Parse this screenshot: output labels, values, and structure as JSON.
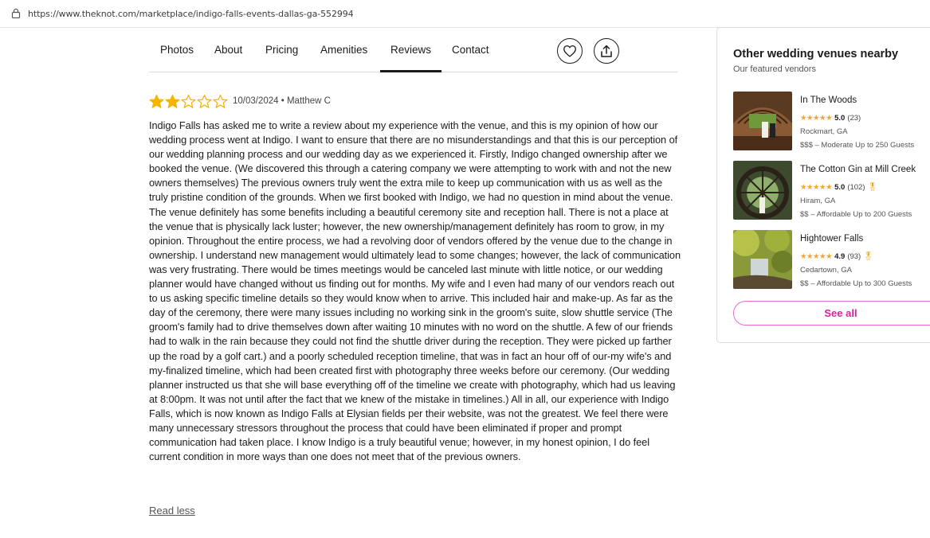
{
  "browser": {
    "url": "https://www.theknot.com/marketplace/indigo-falls-events-dallas-ga-552994"
  },
  "nav": {
    "tabs": [
      {
        "label": "Photos"
      },
      {
        "label": "About"
      },
      {
        "label": "Pricing"
      },
      {
        "label": "Amenities"
      },
      {
        "label": "Reviews",
        "active": true
      },
      {
        "label": "Contact"
      }
    ]
  },
  "review": {
    "rating": 2,
    "max_rating": 5,
    "date": "10/03/2024",
    "author": "Matthew C",
    "meta": "10/03/2024 • Matthew C",
    "text": "Indigo Falls has asked me to write a review about my experience with the venue, and this is my opinion of how our wedding process went at Indigo. I want to ensure that there are no misunderstandings and that this is our perception of our wedding planning process and our wedding day as we experienced it. Firstly, Indigo changed ownership after we booked the venue. (We discovered this through a catering company we were attempting to work with and not the new owners themselves) The previous owners truly went the extra mile to keep up communication with us as well as the truly pristine condition of the grounds. When we first booked with Indigo, we had no question in mind about the venue. The venue definitely has some benefits including a beautiful ceremony site and reception hall. There is not a place at the venue that is physically lack luster; however, the new ownership/management definitely has room to grow, in my opinion. Throughout the entire process, we had a revolving door of vendors offered by the venue due to the change in ownership. I understand new management would ultimately lead to some changes; however, the lack of communication was very frustrating. There would be times meetings would be canceled last minute with little notice, or our wedding planner would have changed without us finding out for months. My wife and I even had many of our vendors reach out to us asking specific timeline details so they would know when to arrive. This included hair and make-up. As far as the day of the ceremony, there were many issues including no working sink in the groom's suite, slow shuttle service (The groom's family had to drive themselves down after waiting 10 minutes with no word on the shuttle. A few of our friends had to walk in the rain because they could not find the shuttle driver during the reception. They were picked up farther up the road by a golf cart.) and a poorly scheduled reception timeline, that was in fact an hour off of our-my wife's and my-finalized timeline, which had been created first with photography three weeks before our ceremony. (Our wedding planner instructed us that she will base everything off of the timeline we create with photography, which had us leaving at 8:00pm. It was not until after the fact that we knew of the mistake in timelines.) All in all, our experience with Indigo Falls, which is now known as Indigo Falls at Elysian fields per their website, was not the greatest. We feel there were many unnecessary stressors throughout the process that could have been eliminated if proper and prompt communication had taken place. I know Indigo is a truly beautiful venue; however, in my honest opinion, I do feel current condition in more ways than one does not meet that of the previous owners.",
    "read_less": "Read less"
  },
  "sidebar": {
    "title": "Other wedding venues nearby",
    "subtitle": "Our featured vendors",
    "venues": [
      {
        "name": "In The Woods",
        "rating": "5.0",
        "count": "(23)",
        "award": false,
        "location": "Rockmart, GA",
        "price": "$$$ – Moderate  Up to 250 Guests"
      },
      {
        "name": "The Cotton Gin at Mill Creek",
        "rating": "5.0",
        "count": "(102)",
        "award": true,
        "location": "Hiram, GA",
        "price": "$$ – Affordable  Up to 200 Guests"
      },
      {
        "name": "Hightower Falls",
        "rating": "4.9",
        "count": "(93)",
        "award": true,
        "location": "Cedartown, GA",
        "price": "$$ – Affordable  Up to 300 Guests"
      }
    ],
    "see_all": "See all"
  },
  "colors": {
    "star": "#f5b400",
    "accent_pink": "#d6239d"
  }
}
